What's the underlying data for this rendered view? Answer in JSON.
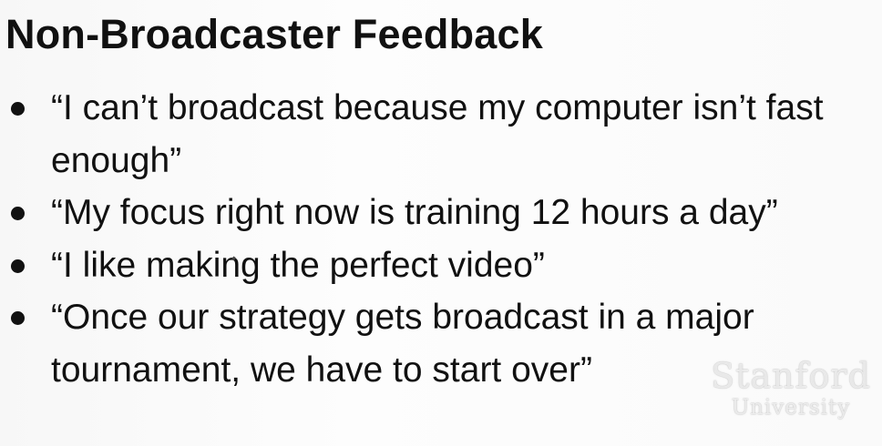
{
  "slide": {
    "title": "Non-Broadcaster Feedback",
    "bullets": [
      {
        "text": "“I can’t broadcast because my computer isn’t fast enough”"
      },
      {
        "text": "“My focus right now is training 12 hours a day”"
      },
      {
        "text": "“I like making the perfect video”"
      },
      {
        "text": "“Once our strategy gets broadcast in a major tournament, we have to start over”"
      }
    ]
  },
  "watermark": {
    "line1": "Stanford",
    "line2": "University"
  }
}
